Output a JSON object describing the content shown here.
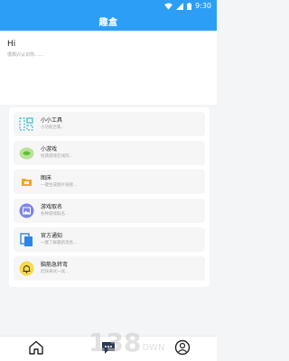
{
  "status_bar": {
    "time": "9:30",
    "icons": [
      "wifi-icon",
      "signal-icon",
      "battery-icon"
    ]
  },
  "header": {
    "title": "趣盒",
    "background_color": "#2d9ef5"
  },
  "greeting": {
    "title": "Hi",
    "subtitle": "很高兴认识你……"
  },
  "tools": [
    {
      "label": "小小工具",
      "desc": "小功能合集...",
      "icon": "tool-grid-icon"
    },
    {
      "label": "小游戏",
      "desc": "经典游戏在线玩...",
      "icon": "game-icon"
    },
    {
      "label": "图床",
      "desc": "一键生成图片链接...",
      "icon": "image-folder-icon"
    },
    {
      "label": "游戏取名",
      "desc": "各种游戏取名...",
      "icon": "picture-icon"
    },
    {
      "label": "官方通知",
      "desc": "一键了解最新消息...",
      "icon": "notice-copy-icon"
    },
    {
      "label": "脑筋急转弯",
      "desc": "赶快来试一试...",
      "icon": "bell-icon"
    }
  ],
  "bottom_nav": [
    {
      "label": "home",
      "icon": "home-icon"
    },
    {
      "label": "message",
      "icon": "message-icon"
    },
    {
      "label": "profile",
      "icon": "profile-icon"
    }
  ],
  "watermark": {
    "text": "138",
    "suffix": "DWN"
  }
}
